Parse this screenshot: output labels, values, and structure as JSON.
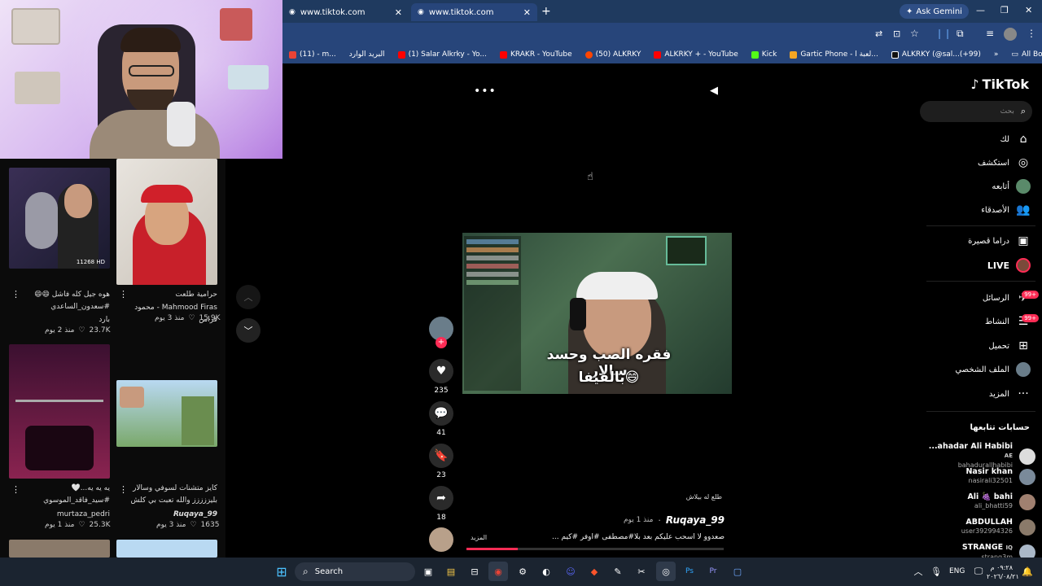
{
  "browser": {
    "tabs": [
      {
        "title": "www.tiktok.com"
      },
      {
        "title": "www.tiktok.com"
      }
    ],
    "ask_gemini": "Ask Gemini",
    "bookmarks": [
      {
        "label": "(11) - m...",
        "color": "#ea4335"
      },
      {
        "label": "البريد الوارد",
        "color": "#ea4335"
      },
      {
        "label": "(1) Salar Alkrky - Yo...",
        "color": "#ff0000"
      },
      {
        "label": "KRAKR - YouTube",
        "color": "#ff0000"
      },
      {
        "label": "(50) ALKRKY",
        "color": "#ff4500"
      },
      {
        "label": "ALKRKY + - YouTube",
        "color": "#ff0000"
      },
      {
        "label": "Kick",
        "color": "#53fc18"
      },
      {
        "label": "Gartic Phone - لعبة ا...",
        "color": "#f5a623"
      },
      {
        "label": "ALKRKY (@sal...(+99)",
        "color": "#000000"
      }
    ],
    "all_bookmarks": "All Bookmarks"
  },
  "tiktok": {
    "logo": "TikTok",
    "search_placeholder": "بحث",
    "nav": [
      {
        "label": "لك",
        "icon": "home-icon"
      },
      {
        "label": "استكشف",
        "icon": "compass-icon"
      },
      {
        "label": "أتابعه",
        "icon": "avatar-icon"
      },
      {
        "label": "الأصدقاء",
        "icon": "friends-icon"
      },
      {
        "label": "دراما قصيرة",
        "icon": "drama-icon"
      },
      {
        "label": "LIVE",
        "icon": "live-icon"
      },
      {
        "label": "الرسائل",
        "icon": "messages-icon",
        "badge": "99+"
      },
      {
        "label": "النشاط",
        "icon": "activity-icon",
        "badge": "99+"
      },
      {
        "label": "تحميل",
        "icon": "upload-icon"
      },
      {
        "label": "الملف الشخصي",
        "icon": "profile-icon"
      },
      {
        "label": "المزيد",
        "icon": "more-icon"
      }
    ],
    "following_title": "حسابات تتابعها",
    "following": [
      {
        "name": "...ahadar Ali Habibi",
        "tag": "AE",
        "handle": "bahadurallhabibi"
      },
      {
        "name": "Nasir khan",
        "tag": "",
        "handle": "nasirali32501"
      },
      {
        "name": "Ali 🍇 bahi",
        "tag": "",
        "handle": "ali_bhatti59"
      },
      {
        "name": "ABDULLAH",
        "tag": "",
        "handle": "user392994326"
      },
      {
        "name": "STRANGE",
        "tag": "IQ",
        "handle": "strang3m"
      }
    ],
    "video": {
      "overlay_line1": "فقره الصب وحسد سالار",
      "overlay_line2": "بالفيفا😄",
      "likes": "235",
      "comments": "41",
      "saves": "23",
      "shares": "18",
      "sound": "طلع له بيلاش",
      "author": "Ruqaya_99",
      "time_ago": "منذ 1 يوم",
      "caption": "صعدوو لا اسحب عليكم بعد بلا#مصطفى #اوفر #كيم ...",
      "more": "المزيد"
    }
  },
  "left_grid": [
    {
      "caption": "هوه جيل كله فاشل 😄😄 #سعدون_الساعدي #نزار_الفارس...",
      "caption2": "بارد",
      "likes": "23.7K",
      "time": "منذ 2 يوم",
      "badge": "11268 HD",
      "colors": [
        "#3a2f55",
        "#1a1a2e"
      ]
    },
    {
      "caption": "حرامية طلعت",
      "caption2": "Mahmood Firas - محمود فراس",
      "likes": "15.9K",
      "time": "منذ 3 يوم",
      "badge": "",
      "colors": [
        "#e8e4de",
        "#c9c2b8"
      ]
    },
    {
      "caption": "يه يه يه...🤍 #سيد_فاقد_الموسوي #سجاد_محمدي . . . . . . . . .",
      "caption2": "murtaza_pedri",
      "likes": "25.3K",
      "time": "منذ 1 يوم",
      "badge": "",
      "colors": [
        "#3b1030",
        "#8a2350"
      ]
    },
    {
      "caption": "كايز متشنات لسوفي وسالار بليززززز والله تعبت بي كلش والآ...",
      "caption2": "Ruqaya_99",
      "likes": "1635",
      "time": "منذ 3 يوم",
      "badge": "",
      "colors": [
        "#b9d9f2",
        "#7aa86a"
      ]
    }
  ],
  "taskbar": {
    "search_label": "Search",
    "lang": "ENG",
    "time": "٠٩:٢٨ م",
    "date": "٢٠٢٦/٠٨/٢١"
  }
}
